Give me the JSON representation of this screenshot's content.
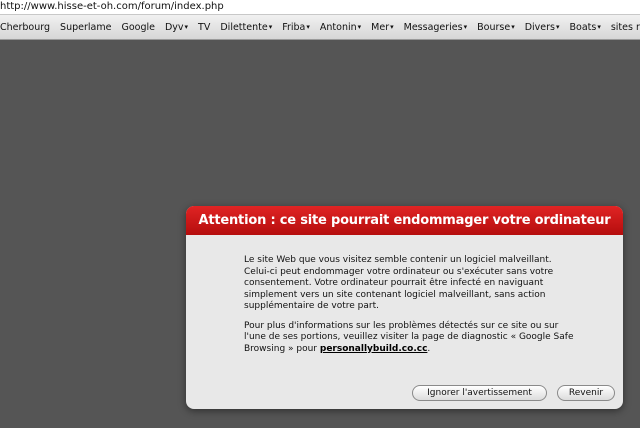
{
  "browser": {
    "url": "http://www.hisse-et-oh.com/forum/index.php",
    "bookmarks": [
      {
        "label": "Cherbourg",
        "menu": false
      },
      {
        "label": "Superlame",
        "menu": false
      },
      {
        "label": "Google",
        "menu": false
      },
      {
        "label": "Dyv",
        "menu": true
      },
      {
        "label": "TV",
        "menu": false
      },
      {
        "label": "Dilettente",
        "menu": true
      },
      {
        "label": "Friba",
        "menu": true
      },
      {
        "label": "Antonin",
        "menu": true
      },
      {
        "label": "Mer",
        "menu": true
      },
      {
        "label": "Messageries",
        "menu": true
      },
      {
        "label": "Bourse",
        "menu": true
      },
      {
        "label": "Divers",
        "menu": true
      },
      {
        "label": "Boats",
        "menu": true
      },
      {
        "label": "sites ren",
        "menu": false
      }
    ]
  },
  "dialog": {
    "title": "Attention : ce site pourrait endommager votre ordinateur",
    "paragraph1": "Le site Web que vous visitez semble contenir un logiciel malveillant. Celui-ci peut endommager votre ordinateur ou s'exécuter sans votre consentement. Votre ordinateur pourrait être infecté en naviguant simplement vers un site contenant logiciel malveillant, sans action supplémentaire de votre part.",
    "paragraph2_prefix": "Pour plus d'informations sur les problèmes détectés sur ce site ou sur l'une de ses portions, veuillez visiter la page de diagnostic « Google Safe Browsing » pour ",
    "site_link": "personallybuild.co.cc",
    "paragraph2_suffix": ".",
    "ignore_button": "Ignorer l'avertissement",
    "back_button": "Revenir"
  }
}
